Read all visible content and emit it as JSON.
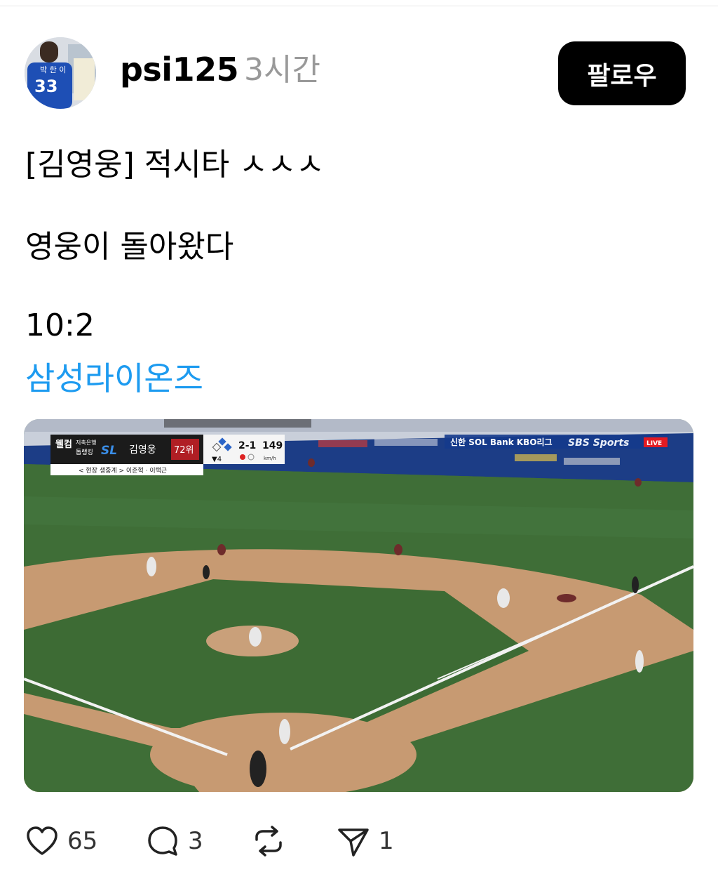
{
  "post": {
    "username": "psi125",
    "time": "3시간",
    "follow_label": "팔로우",
    "avatar": {
      "jersey_number": "33",
      "jersey_name": "박 한 이"
    },
    "lines": [
      "[김영웅] 적시타 ㅅㅅㅅ",
      "영웅이 돌아왔다",
      "10:2"
    ],
    "hashtag": "삼성라이온즈"
  },
  "video": {
    "scoreboard": {
      "sponsor_line1": "웰컴",
      "sponsor_line2": "저축은행",
      "sponsor_line3": "톱랭킹",
      "team_logo": "SL",
      "player": "김영웅",
      "rank": "72위",
      "inning": "▼4",
      "count": "2-1",
      "speed": "149",
      "speed_unit": "km/h",
      "commentary": "< 현장 생중계 > 이준혁 · 이택근"
    },
    "broadcast": {
      "sponsor": "신한 SOL Bank KBO리그",
      "channel": "SBS Sports",
      "live": "LIVE"
    }
  },
  "actions": {
    "likes": "65",
    "replies": "3",
    "reposts": "",
    "shares": "1"
  }
}
